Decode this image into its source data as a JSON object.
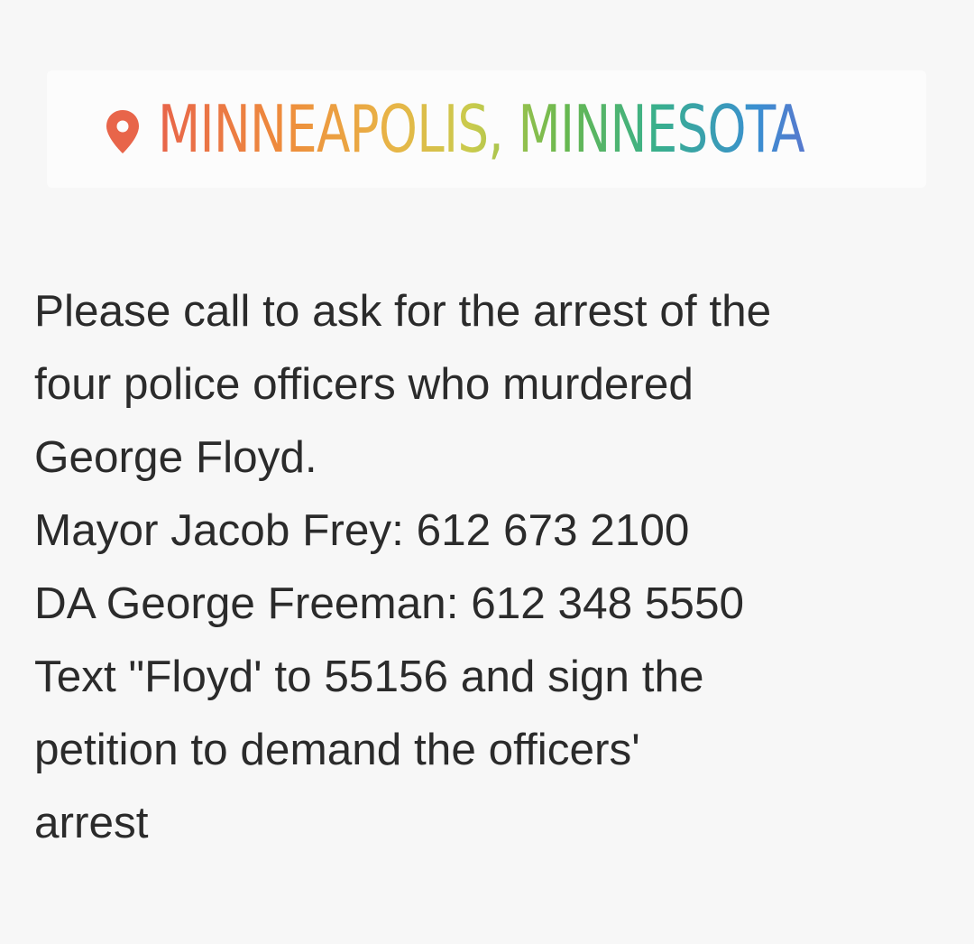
{
  "location": {
    "label": "MINNEAPOLIS, MINNESOTA",
    "icon": "location-pin-icon",
    "pin_color": "#e8654a"
  },
  "message": {
    "lines": [
      "Please call to ask for the arrest of the",
      "four police officers who murdered",
      "George Floyd.",
      "Mayor Jacob Frey: 612 673 2100",
      "DA George Freeman: 612 348 5550",
      "Text \"Floyd' to 55156 and sign the",
      "petition to demand the officers'",
      "arrest"
    ]
  }
}
